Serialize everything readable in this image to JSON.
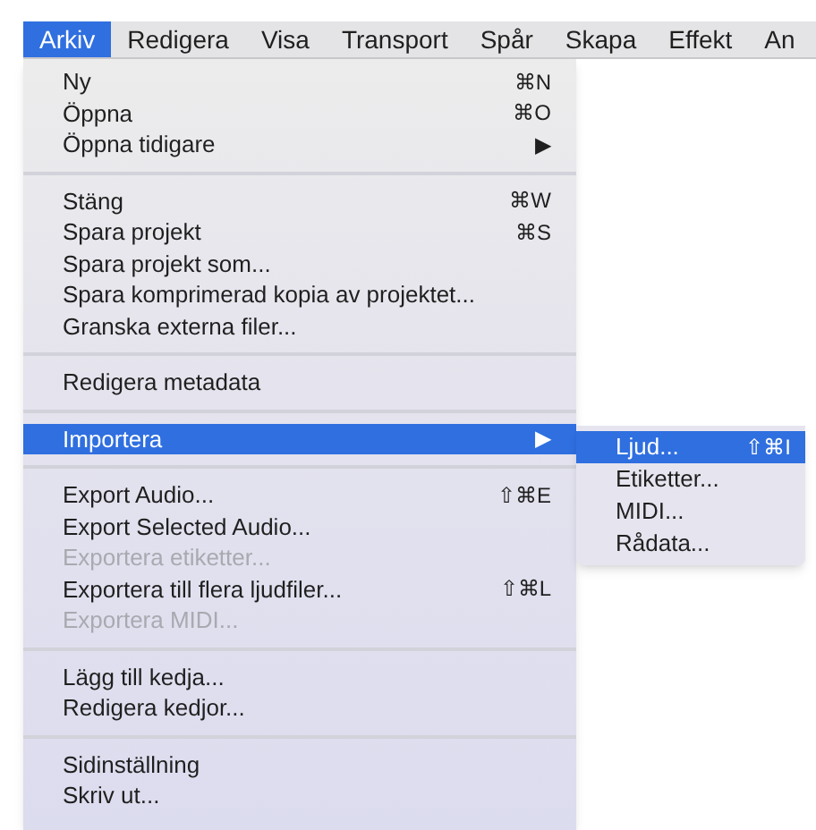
{
  "menubar": [
    {
      "label": "Arkiv",
      "selected": true
    },
    {
      "label": "Redigera",
      "selected": false
    },
    {
      "label": "Visa",
      "selected": false
    },
    {
      "label": "Transport",
      "selected": false
    },
    {
      "label": "Spår",
      "selected": false
    },
    {
      "label": "Skapa",
      "selected": false
    },
    {
      "label": "Effekt",
      "selected": false
    },
    {
      "label": "An",
      "selected": false
    }
  ],
  "menu": {
    "sections": [
      [
        {
          "label": "Ny",
          "shortcut": "⌘N",
          "disabled": false,
          "selected": false
        },
        {
          "label": "Öppna",
          "shortcut": "⌘O",
          "disabled": false,
          "selected": false
        },
        {
          "label": "Öppna tidigare",
          "shortcut": "▶",
          "disabled": false,
          "selected": false
        }
      ],
      [
        {
          "label": "Stäng",
          "shortcut": "⌘W",
          "disabled": false,
          "selected": false
        },
        {
          "label": "Spara projekt",
          "shortcut": "⌘S",
          "disabled": false,
          "selected": false
        },
        {
          "label": "Spara projekt som...",
          "disabled": false,
          "selected": false
        },
        {
          "label": "Spara komprimerad kopia av projektet...",
          "disabled": false,
          "selected": false
        },
        {
          "label": "Granska externa filer...",
          "disabled": false,
          "selected": false
        }
      ],
      [
        {
          "label": "Redigera metadata",
          "disabled": false,
          "selected": false
        }
      ],
      [
        {
          "label": "Importera",
          "shortcut": "▶",
          "disabled": false,
          "selected": true
        }
      ],
      [
        {
          "label": "Export Audio...",
          "shortcut": "⇧⌘E",
          "disabled": false,
          "selected": false
        },
        {
          "label": "Export Selected Audio...",
          "disabled": false,
          "selected": false
        },
        {
          "label": "Exportera etiketter...",
          "disabled": true,
          "selected": false
        },
        {
          "label": "Exportera till flera ljudfiler...",
          "shortcut": "⇧⌘L",
          "disabled": false,
          "selected": false
        },
        {
          "label": "Exportera MIDI...",
          "disabled": true,
          "selected": false
        }
      ],
      [
        {
          "label": "Lägg till kedja...",
          "disabled": false,
          "selected": false
        },
        {
          "label": "Redigera kedjor...",
          "disabled": false,
          "selected": false
        }
      ],
      [
        {
          "label": "Sidinställning",
          "disabled": false,
          "selected": false
        },
        {
          "label": "Skriv ut...",
          "disabled": false,
          "selected": false
        }
      ]
    ]
  },
  "submenu": {
    "items": [
      {
        "label": "Ljud...",
        "shortcut": "⇧⌘I",
        "selected": true
      },
      {
        "label": "Etiketter...",
        "selected": false
      },
      {
        "label": "MIDI...",
        "selected": false
      },
      {
        "label": "Rådata...",
        "selected": false
      }
    ]
  }
}
